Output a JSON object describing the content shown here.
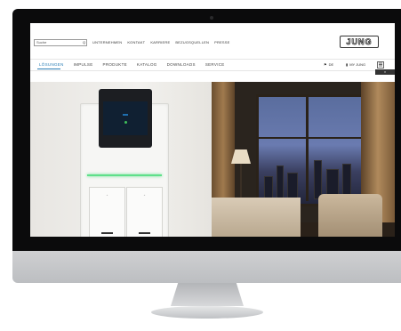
{
  "header": {
    "search_placeholder": "Suche",
    "search_button": "Q",
    "top_links": [
      "UNTERNEHMEN",
      "KONTAKT",
      "KARRIERE",
      "BEZUGSQUELLEN",
      "PRESSE"
    ],
    "logo_text": "JUNG"
  },
  "main_nav": {
    "items": [
      "LÖSUNGEN",
      "IMPULSE",
      "PRODUKTE",
      "KATALOG",
      "DOWNLOADS",
      "SERVICE"
    ],
    "active_index": 0,
    "language": "DE",
    "account": "MY JUNG"
  },
  "close_tab": "×",
  "hero": {
    "display_label": "",
    "key_symbols": [
      "◦ ",
      "◦"
    ]
  }
}
